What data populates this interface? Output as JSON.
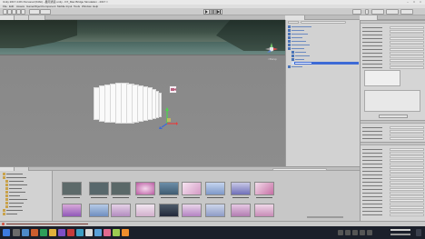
{
  "window": {
    "title": "Unity 2017.4.0f1 Personal (64bit) - 星际通道.unity - FX_Max Bridge Simulation - 2017 ="
  },
  "menu": [
    {
      "label": "File"
    },
    {
      "label": "Edit"
    },
    {
      "label": "Assets"
    },
    {
      "label": "GameObject"
    },
    {
      "label": "Component"
    },
    {
      "label": "Mobile Input"
    },
    {
      "label": "Tools"
    },
    {
      "label": "Window"
    },
    {
      "label": "Help"
    }
  ],
  "toolbar": {
    "tools": [
      "hand-icon",
      "move-icon",
      "rotate-icon",
      "scale-icon",
      "rect-icon"
    ]
  },
  "scene": {
    "tabs": [
      {
        "name": "scene-tab"
      },
      {
        "name": "game-tab"
      },
      {
        "name": "animator-tab"
      }
    ]
  },
  "hierarchy": {
    "tab": "Hierarchy"
  },
  "inspector": {
    "tab": "Inspector"
  },
  "project": {
    "tab": "Project"
  },
  "status": {
    "text": ""
  },
  "colors": {
    "accent": "#4a74b8",
    "selection": "#3d6ad6",
    "editor_bg": "#c2c2c2",
    "taskbar": "#1b1f2a"
  }
}
